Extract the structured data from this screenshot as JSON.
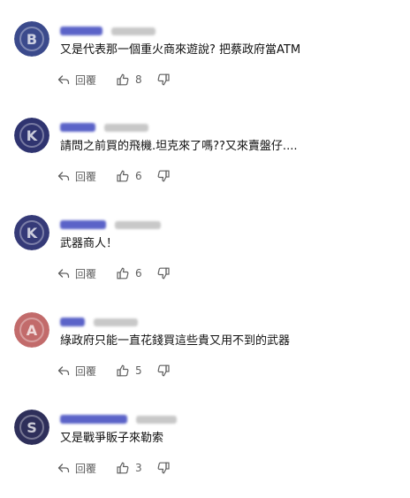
{
  "reply_label": "回覆",
  "colors": {
    "author_blur": "#5b63c8",
    "action_text": "#606060"
  },
  "comments": [
    {
      "author": "Bogar",
      "timestamp": "1 個月前",
      "text": "又是代表那一個重火商來遊說? 把蔡政府當ATM",
      "likes": "8",
      "avatar_color": "#3b4a8c",
      "avatar_letter": "B"
    },
    {
      "author": "Kevin",
      "timestamp": "1 個月前",
      "text": "請問之前買的飛機.坦克來了嗎??又來賣盤仔....",
      "likes": "6",
      "avatar_color": "#2f3470",
      "avatar_letter": "K"
    },
    {
      "author": "Kingso",
      "timestamp": "1 個月前",
      "text": "武器商人！",
      "likes": "6",
      "avatar_color": "#353a78",
      "avatar_letter": "K"
    },
    {
      "author": "AML",
      "timestamp": "1 個月前",
      "text": "綠政府只能一直花錢買這些貴又用不到的武器",
      "likes": "5",
      "avatar_color": "#c26b6b",
      "avatar_letter": "A"
    },
    {
      "author": "sharingyou",
      "timestamp": "1 個月前",
      "text": "又是戰爭販子來勒索",
      "likes": "3",
      "avatar_color": "#2e2f5a",
      "avatar_letter": "S"
    }
  ]
}
